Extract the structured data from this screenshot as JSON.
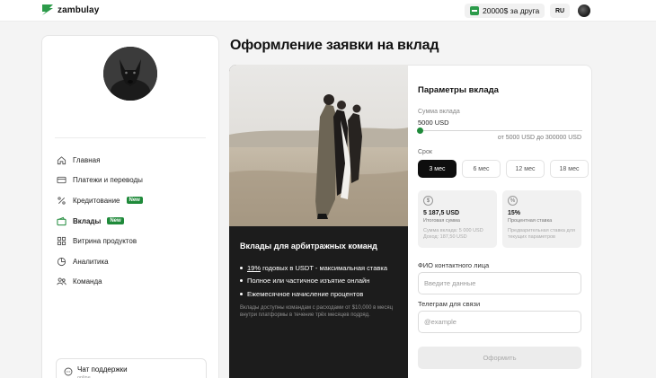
{
  "header": {
    "logo_text": "zambulay",
    "promo_label": "20000$ за друга",
    "lang_label": "RU"
  },
  "sidebar": {
    "items": [
      {
        "label": "Главная",
        "icon": "home-icon"
      },
      {
        "label": "Платежи и переводы",
        "icon": "card-icon"
      },
      {
        "label": "Кредитование",
        "icon": "percent-icon",
        "badge": "New"
      },
      {
        "label": "Вклады",
        "icon": "wallet-icon",
        "badge": "New",
        "active": true
      },
      {
        "label": "Витрина продуктов",
        "icon": "grid-icon"
      },
      {
        "label": "Аналитика",
        "icon": "analytics-icon"
      },
      {
        "label": "Команда",
        "icon": "team-icon"
      }
    ],
    "support": {
      "label": "Чат поддержки",
      "status": "online"
    }
  },
  "main": {
    "title": "Оформление заявки на вклад"
  },
  "promo_card": {
    "title": "Вклады для арбитражных команд",
    "bullets": {
      "first_highlight": "19%",
      "first_rest": " годовых в USDT - максимальная ставка",
      "second": "Полное или частичное изъятие онлайн",
      "third": "Ежемесячное начисление процентов"
    },
    "note": "Вклады доступны командам с расходами от $10,000 в месяц внутри платформы в течение трёх месяцев подряд."
  },
  "params": {
    "title": "Параметры вклада",
    "amount_label": "Сумма вклада",
    "amount_value": "5000 USD",
    "amount_fraction": 0.0,
    "range_label": "от 5000 USD до 300000 USD",
    "term_label": "Срок",
    "terms": [
      "3 мес",
      "6 мес",
      "12 мес",
      "18 мес"
    ],
    "selected_term": "3 мес",
    "total_card": {
      "icon": "dollar-icon",
      "value": "5 187,5 USD",
      "caption": "Итоговая сумма",
      "detail": "Сумма вклада: 5 000 USD Доход: 187,50 USD"
    },
    "rate_card": {
      "icon": "percent-icon",
      "value": "15%",
      "caption": "Процентная ставка",
      "detail": "Предварительная ставка для текущих параметров"
    },
    "contact_label": "ФИО контактного лица",
    "contact_placeholder": "Введите данные",
    "telegram_label": "Телеграм для связи",
    "telegram_placeholder": "@example",
    "submit_label": "Оформить"
  },
  "colors": {
    "accent": "#1f8a3a",
    "dark": "#1c1c1c",
    "background": "#f4f4f4"
  }
}
